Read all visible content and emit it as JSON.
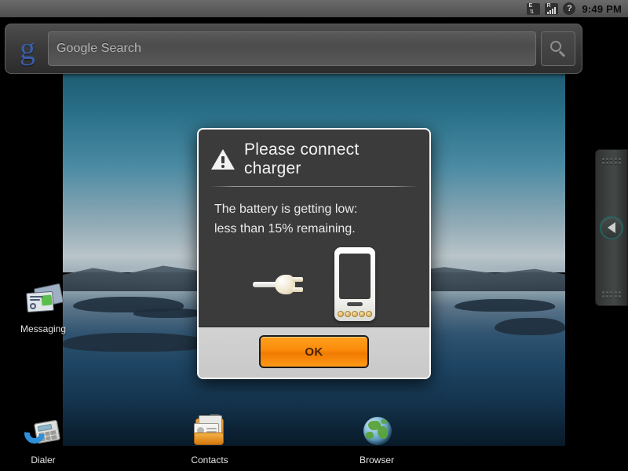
{
  "status_bar": {
    "clock": "9:49 PM",
    "icons": [
      {
        "name": "edge-data-icon",
        "label": "E"
      },
      {
        "name": "signal-roaming-icon",
        "label": "R"
      },
      {
        "name": "help-unknown-icon",
        "label": "?"
      }
    ]
  },
  "search_widget": {
    "logo_glyph": "g",
    "placeholder": "Google Search",
    "search_icon": "search-icon"
  },
  "apps": [
    {
      "name": "messaging",
      "label": "Messaging"
    },
    {
      "name": "dialer",
      "label": "Dialer"
    },
    {
      "name": "contacts",
      "label": "Contacts"
    },
    {
      "name": "browser",
      "label": "Browser"
    }
  ],
  "drawer": {
    "handle_icon": "chevron-left-icon"
  },
  "dialog": {
    "title": "Please connect charger",
    "icon": "warning-triangle-icon",
    "message_line1": "The battery is getting low:",
    "message_line2": "less than 15% remaining.",
    "artwork": {
      "plug_icon": "power-plug-icon",
      "phone_icon": "phone-device-icon"
    },
    "ok_label": "OK"
  },
  "colors": {
    "accent_orange": "#fb8b0a",
    "dialog_bg": "#3b3b3b",
    "status_bar_bg": "#5b5b5b",
    "google_blue": "#3b5ea8"
  }
}
